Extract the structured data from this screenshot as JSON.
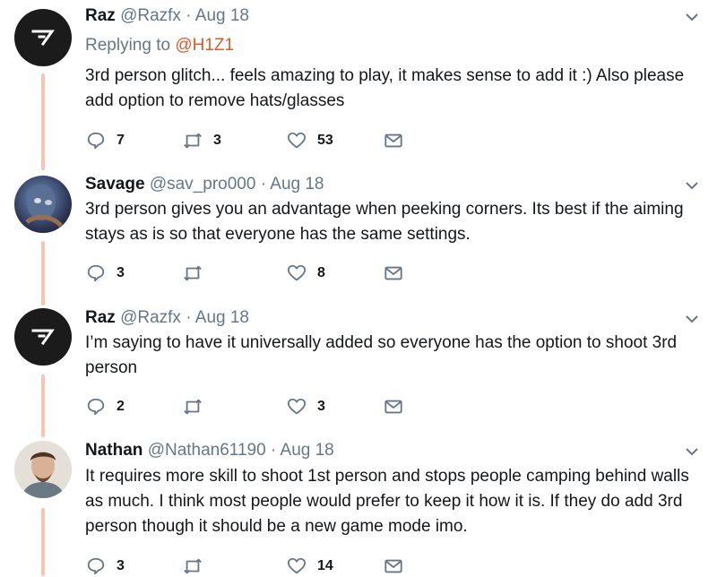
{
  "tweets": [
    {
      "name": "Raz",
      "handle": "@Razfx",
      "date": "Aug 18",
      "replying_label": "Replying to",
      "replying_mention": "@H1Z1",
      "text_lines": [
        "3rd person glitch... feels amazing to play, it makes sense to add it :) Also please",
        "add option to remove hats/glasses"
      ],
      "counts": {
        "replies": "7",
        "retweets": "3",
        "likes": "53"
      }
    },
    {
      "name": "Savage",
      "handle": "@sav_pro000",
      "date": "Aug 18",
      "text_lines": [
        "3rd person gives you an advantage when peeking corners. Its best if the aiming",
        "stays as is so that everyone has the same settings."
      ],
      "counts": {
        "replies": "3",
        "retweets": "",
        "likes": "8"
      }
    },
    {
      "name": "Raz",
      "handle": "@Razfx",
      "date": "Aug 18",
      "text_lines": [
        "I’m saying to have it universally added so everyone has the option to shoot 3rd",
        "person"
      ],
      "counts": {
        "replies": "2",
        "retweets": "",
        "likes": "3"
      }
    },
    {
      "name": "Nathan",
      "handle": "@Nathan61190",
      "date": "Aug 18",
      "text_lines": [
        "It requires more skill to shoot 1st person and stops people camping behind walls",
        "as much. I think most people would prefer to keep it how it is. If they do add 3rd",
        "person though it should be a new game mode imo."
      ],
      "counts": {
        "replies": "3",
        "retweets": "",
        "likes": "14"
      }
    }
  ],
  "separator": "·",
  "colors": {
    "thread_line": "#f7c6b2",
    "mention": "#e0592a",
    "muted": "#657786"
  }
}
